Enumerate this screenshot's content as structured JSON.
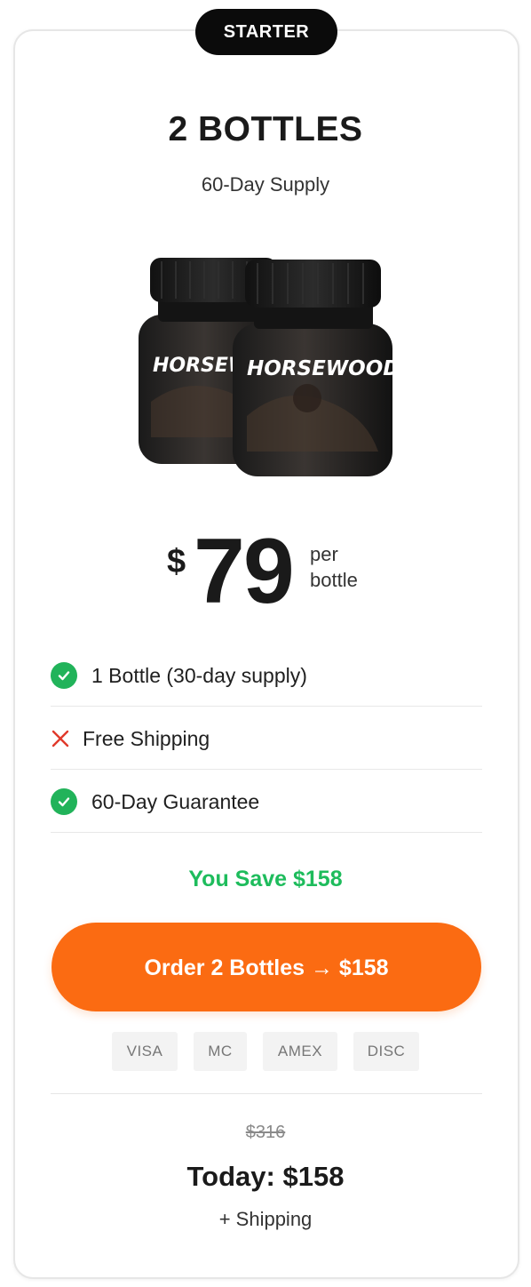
{
  "badge": {
    "label": "STARTER"
  },
  "offer": {
    "title": "2 BOTTLES",
    "subtitle": "60-Day Supply"
  },
  "product": {
    "brand": "HORSEWOOD",
    "brand_partial": "HORSEW",
    "bottle_count": 2
  },
  "price": {
    "currency": "$",
    "amount": "79",
    "unit_line1": "per",
    "unit_line2": "bottle"
  },
  "features": [
    {
      "label": "1 Bottle (30-day supply)",
      "icon": "check-circle-icon",
      "included": true
    },
    {
      "label": "Free Shipping",
      "icon": "x-icon",
      "included": false
    },
    {
      "label": "60-Day Guarantee",
      "icon": "check-circle-icon",
      "included": true
    }
  ],
  "savings": {
    "label": "You Save $158"
  },
  "order_button": {
    "label": "Order 2 Bottles → $158"
  },
  "payment_methods": [
    "VISA",
    "MC",
    "AMEX",
    "DISC"
  ],
  "summary": {
    "original_price": "$316",
    "today_price": "Today: $158",
    "shipping_note": "+ Shipping"
  },
  "colors": {
    "accent_orange": "#fb6b12",
    "savings_green": "#1ebc5c",
    "check_green": "#21b35a",
    "cross_red": "#e0392b",
    "badge_black": "#0b0b0b"
  }
}
